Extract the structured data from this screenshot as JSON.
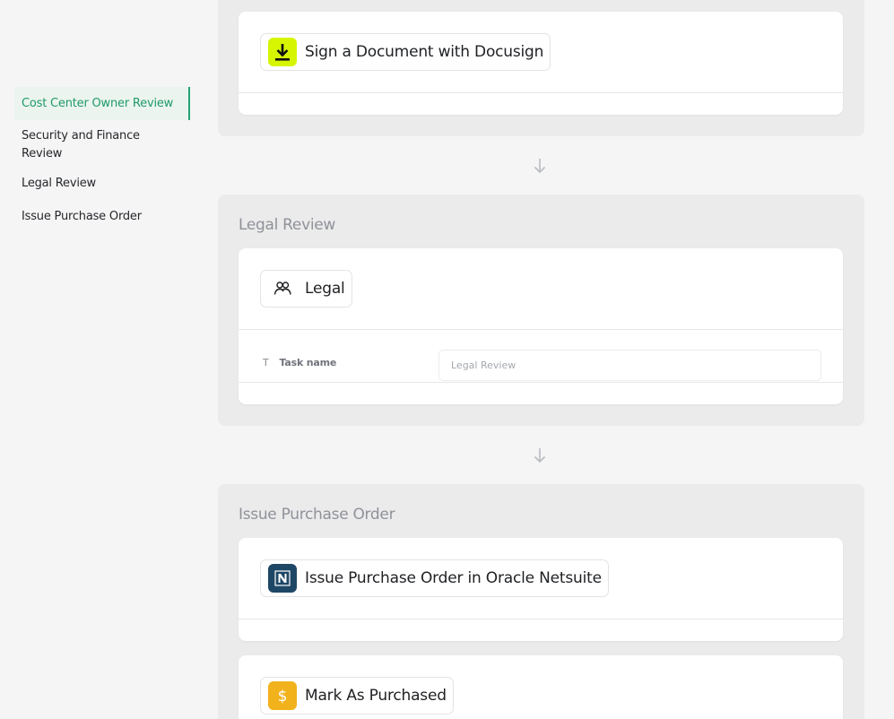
{
  "sidebar": {
    "items": [
      {
        "label": "Cost Center Owner Review",
        "active": true
      },
      {
        "label": "Security and Finance Review",
        "active": false
      },
      {
        "label": "Legal Review",
        "active": false
      },
      {
        "label": "Issue Purchase Order",
        "active": false
      }
    ]
  },
  "sections": {
    "docusign": {
      "action_label": "Sign a Document with Docusign",
      "icon": "download-icon",
      "icon_bg": "#d6f500"
    },
    "legal": {
      "title": "Legal Review",
      "action_label": "Legal",
      "icon": "users-icon",
      "field": {
        "label": "Task name",
        "placeholder": "Legal Review"
      }
    },
    "purchase": {
      "title": "Issue Purchase Order",
      "actions": [
        {
          "label": "Issue Purchase Order in Oracle Netsuite",
          "icon": "netsuite-logo-icon",
          "icon_bg": "#1e4766"
        },
        {
          "label": "Mark As Purchased",
          "icon": "dollar-icon",
          "icon_bg": "#f1b21c"
        }
      ]
    }
  },
  "colors": {
    "accent": "#26a276",
    "accent_bg": "#ebf4ef",
    "section_bg": "#ebebeb",
    "page_bg": "#f5f5f6"
  }
}
